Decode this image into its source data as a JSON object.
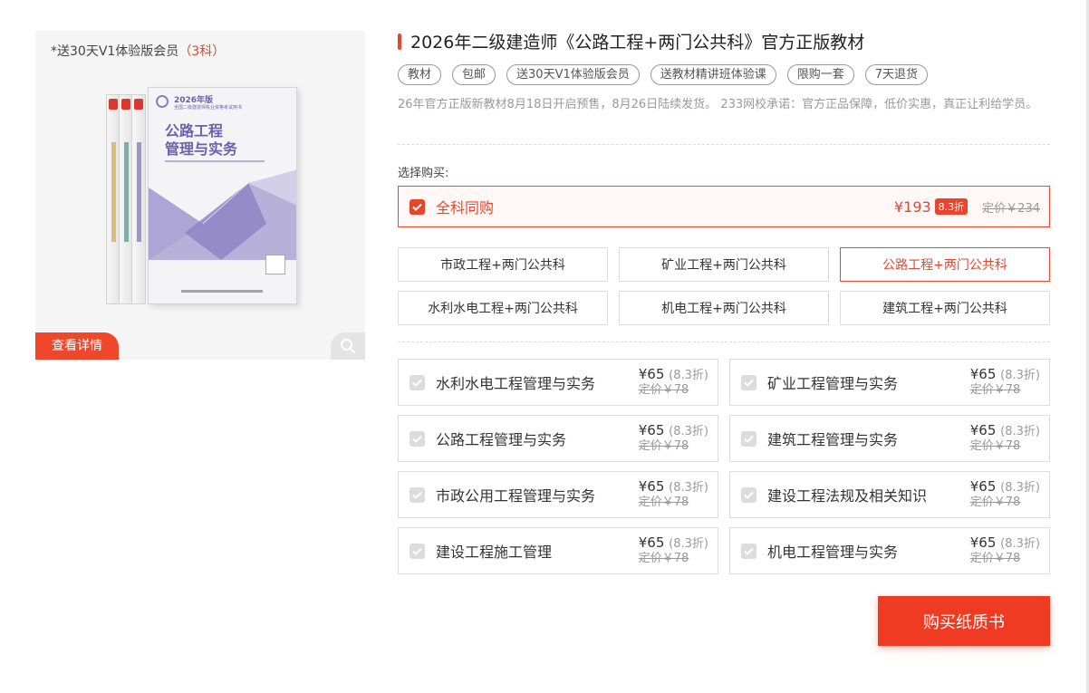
{
  "product": {
    "gift_note_prefix": "*送30天V1体验版会员",
    "gift_note_count": "（3科）",
    "detail_label": "查看详情",
    "cover": {
      "year": "2026年版",
      "series": "全国二级建造师执业资格考试用书",
      "title_line1": "公路工程",
      "title_line2": "管理与实务"
    }
  },
  "title": "2026年二级建造师《公路工程+两门公共科》官方正版教材",
  "tags": [
    "教材",
    "包邮",
    "送30天V1体验版会员",
    "送教材精讲班体验课",
    "限购一套",
    "7天退货"
  ],
  "description": "26年官方正版新教材8月18日开启预售，8月26日陆续发货。 233网校承诺：官方正品保障，低价实惠，真正让利给学员。",
  "choose_label": "选择购买:",
  "all_subjects": {
    "label": "全科同购",
    "price": "¥193",
    "discount": "8.3折",
    "original": "定价￥234"
  },
  "options": [
    {
      "label": "市政工程+两门公共科",
      "active": false
    },
    {
      "label": "矿业工程+两门公共科",
      "active": false
    },
    {
      "label": "公路工程+两门公共科",
      "active": true
    },
    {
      "label": "水利水电工程+两门公共科",
      "active": false
    },
    {
      "label": "机电工程+两门公共科",
      "active": false
    },
    {
      "label": "建筑工程+两门公共科",
      "active": false
    }
  ],
  "subjects": [
    {
      "name": "水利水电工程管理与实务",
      "price": "¥65",
      "discount": "(8.3折)",
      "original": "定价￥78"
    },
    {
      "name": "矿业工程管理与实务",
      "price": "¥65",
      "discount": "(8.3折)",
      "original": "定价￥78"
    },
    {
      "name": "公路工程管理与实务",
      "price": "¥65",
      "discount": "(8.3折)",
      "original": "定价￥78"
    },
    {
      "name": "建筑工程管理与实务",
      "price": "¥65",
      "discount": "(8.3折)",
      "original": "定价￥78"
    },
    {
      "name": "市政公用工程管理与实务",
      "price": "¥65",
      "discount": "(8.3折)",
      "original": "定价￥78"
    },
    {
      "name": "建设工程法规及相关知识",
      "price": "¥65",
      "discount": "(8.3折)",
      "original": "定价￥78"
    },
    {
      "name": "建设工程施工管理",
      "price": "¥65",
      "discount": "(8.3折)",
      "original": "定价￥78"
    },
    {
      "name": "机电工程管理与实务",
      "price": "¥65",
      "discount": "(8.3折)",
      "original": "定价￥78"
    }
  ],
  "buy_label": "购买纸质书",
  "colors": {
    "accent": "#e8452c",
    "button": "#ef3b22",
    "border": "#dcdcdc",
    "muted": "#999999"
  }
}
